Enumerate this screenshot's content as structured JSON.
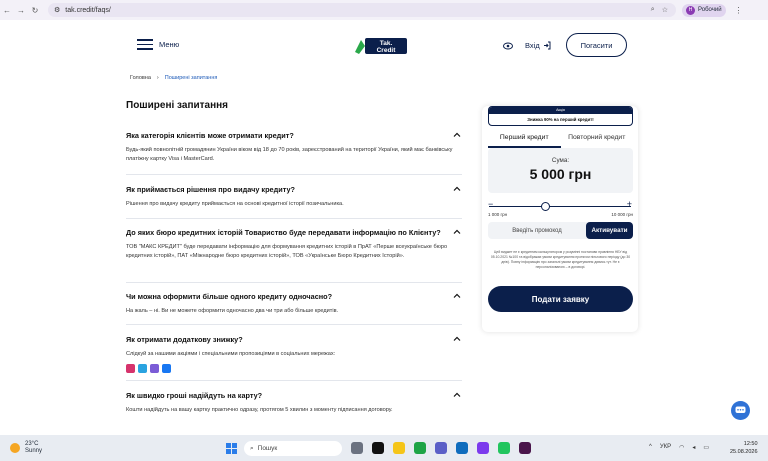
{
  "browser": {
    "url": "tak.credit/faqs/",
    "profile_initial": "Н",
    "profile_name": "Робочий"
  },
  "header": {
    "menu_label": "Меню",
    "logo_text_1": "Tak.",
    "logo_text_2": "Credit",
    "login_label": "Вхід",
    "repay_label": "Погасити"
  },
  "breadcrumbs": {
    "home": "Головна",
    "current": "Поширені запитання"
  },
  "faq": {
    "title": "Поширені запитання",
    "items": [
      {
        "question": "Яка категорія клієнтів може отримати кредит?",
        "answer": "Будь-який повнолітній громадянин України віком від 18 до 70 років, зареєстрований на території України, який має банківську платіжну картку Visa і MasterCard."
      },
      {
        "question": "Як приймається рішення про видачу кредиту?",
        "answer": "Рішення про видачу кредиту приймається на основі кредитної історії позичальника."
      },
      {
        "question": "До яких бюро кредитних історій Товариство буде передавати інформацію по Клієнту?",
        "answer": "ТОВ \"МАКС КРЕДИТ\" буде передавати інформацію для формування кредитних історій в ПрАТ «Перше всеукраїнське бюро кредитних історій», ПАТ «Міжнародне бюро кредитних історій», ТОВ «Українське Бюро Кредитних Історій»."
      },
      {
        "question": "Чи можна оформити більше одного кредиту одночасно?",
        "answer": "На жаль – ні. Ви не можете оформити одночасно два чи три або більше кредитів."
      },
      {
        "question": "Як отримати додаткову знижку?",
        "answer": "Слідкуй за нашими акціями і спеціальними пропозиціями в соціальних мережах:"
      },
      {
        "question": "Як швидко гроші надійдуть на карту?",
        "answer": "Кошти надійдуть на вашу картку практично одразу, протягом 5 хвилин з моменту підписання договору."
      }
    ]
  },
  "calculator": {
    "promo_badge": "Акція",
    "promo_text": "Знижка 90% на перший кредит!",
    "tabs": [
      "Перший кредит",
      "Повторний кредит"
    ],
    "active_tab": 0,
    "sum_label": "Сума:",
    "sum_value": "5 000 грн",
    "slider_fraction": 0.4,
    "min_label": "1 000 грн",
    "max_label": "10 000 грн",
    "promo_placeholder": "Введіть промокод",
    "activate_label": "Активувати",
    "disclaimer": "Цей виджет не є кредитним калькулятором у розумінні постанови правління НБУ від 05.10.2021 №100 та відображає умови кредитування протягом пільгового періоду (до 30 днів). Повну інформацію про загальні умови кредитування дивись тут. Не є персоналізованою – в договорі.",
    "submit_label": "Подати заявку"
  },
  "taskbar": {
    "temp": "23°C",
    "weather": "Sunny",
    "search": "Пошук",
    "lang": "УКР",
    "time": "12:50",
    "date": "25.08.2026"
  },
  "colors": {
    "brand": "#0b1f4b",
    "accent": "#2f72d6"
  }
}
